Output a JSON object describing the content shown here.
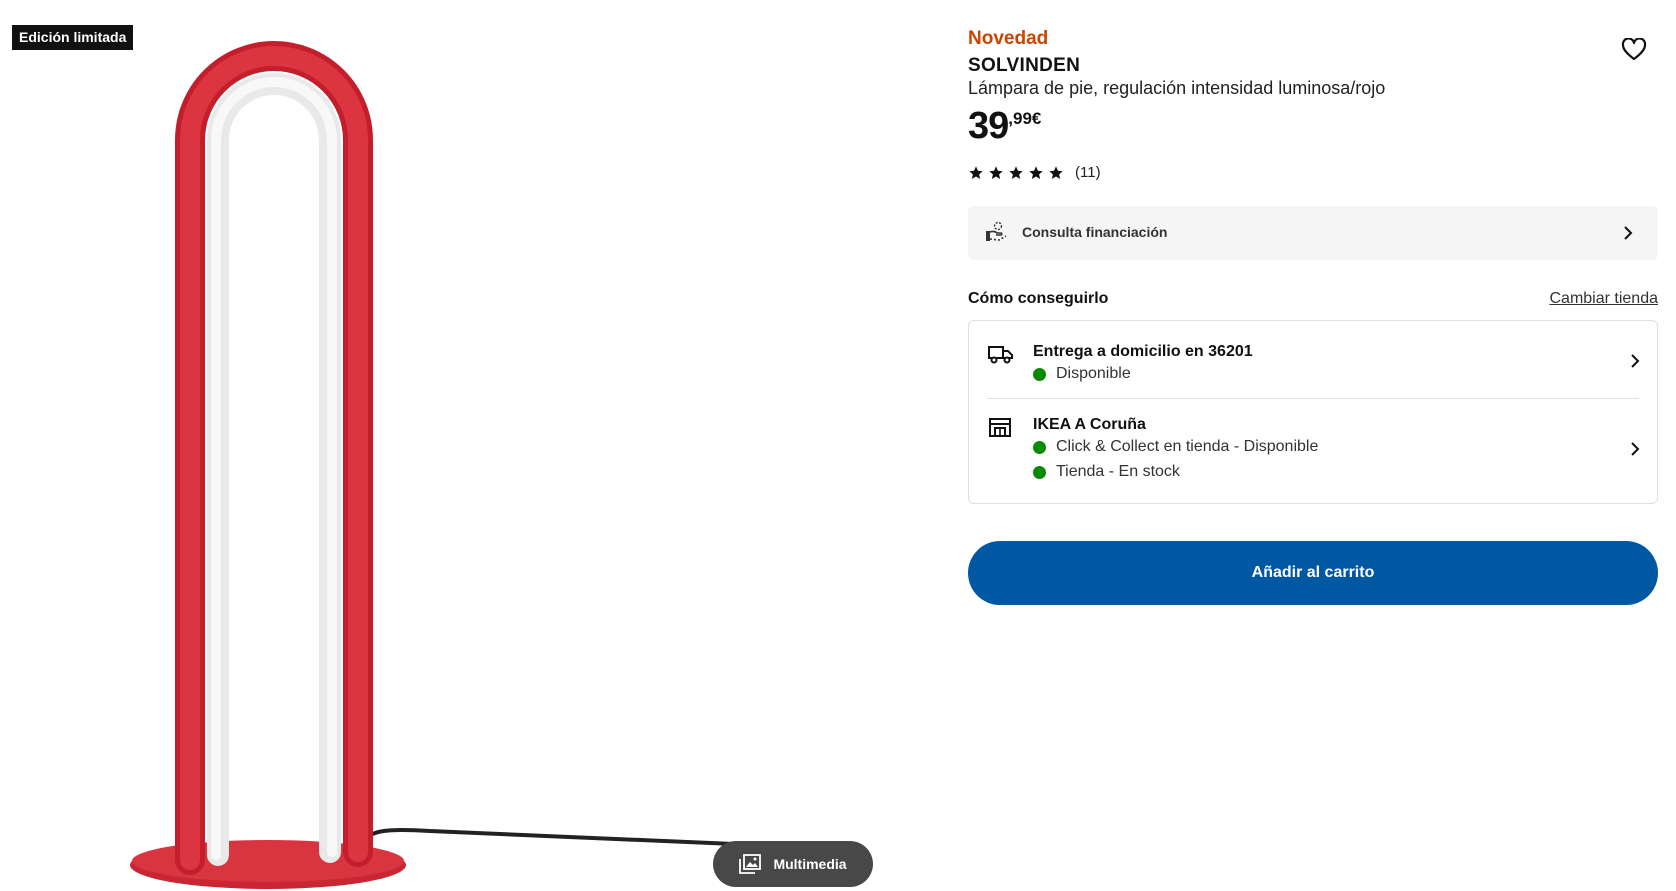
{
  "badge": {
    "label": "Edición limitada"
  },
  "gallery": {
    "media_label": "Multimedia",
    "media_icon": "gallery-icon",
    "lamp_color": "#D42A35",
    "cord_color": "#222222"
  },
  "product": {
    "tag": "Novedad",
    "name": "SOLVINDEN",
    "description": "Lámpara de pie, regulación intensidad luminosa/rojo",
    "price_integer": "39",
    "price_decimal": ",99€",
    "rating_stars": 5,
    "rating_count": "(11)",
    "favorite_icon": "heart-icon"
  },
  "financing": {
    "label": "Consulta financiación",
    "icon": "financing-icon"
  },
  "availability": {
    "title": "Cómo conseguirlo",
    "change_store": "Cambiar tienda",
    "delivery": {
      "icon": "truck-icon",
      "title": "Entrega a domicilio en 36201",
      "status": "Disponible"
    },
    "store": {
      "icon": "store-icon",
      "title": "IKEA A Coruña",
      "status_1": "Click & Collect en tienda - Disponible",
      "status_2": "Tienda - En stock"
    },
    "status_color": "#0A8A00"
  },
  "cart": {
    "label": "Añadir al carrito",
    "color": "#0058A3"
  },
  "colors": {
    "tag": "#CC4400",
    "panel": "#F5F5F5"
  }
}
